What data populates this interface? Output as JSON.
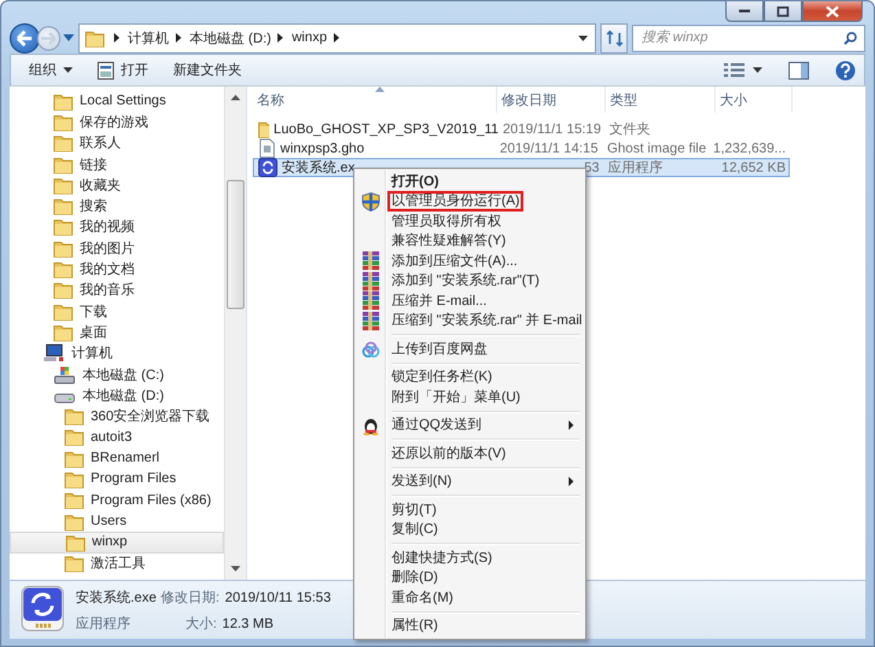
{
  "address": {
    "crumbs": [
      "计算机",
      "本地磁盘 (D:)",
      "winxp"
    ]
  },
  "search": {
    "placeholder": "搜索 winxp"
  },
  "toolbar": {
    "items": [
      {
        "label": "组织",
        "kind": "dropdown"
      },
      {
        "label": "打开",
        "kind": "open"
      },
      {
        "label": "新建文件夹",
        "kind": "plain"
      }
    ]
  },
  "sidebar": {
    "user_folders": [
      {
        "label": "Local Settings",
        "selected": false
      },
      {
        "label": "保存的游戏",
        "selected": false
      },
      {
        "label": "联系人",
        "selected": false
      },
      {
        "label": "链接",
        "selected": false
      },
      {
        "label": "收藏夹",
        "selected": false
      },
      {
        "label": "搜索",
        "selected": false
      },
      {
        "label": "我的视频",
        "selected": false
      },
      {
        "label": "我的图片",
        "selected": false
      },
      {
        "label": "我的文档",
        "selected": false
      },
      {
        "label": "我的音乐",
        "selected": false
      },
      {
        "label": "下载",
        "selected": false
      },
      {
        "label": "桌面",
        "selected": false
      }
    ],
    "tree": [
      {
        "label": "计算机",
        "kind": "computer",
        "selected": false,
        "children": [
          {
            "label": "本地磁盘 (C:)",
            "kind": "system-drive",
            "selected": false
          },
          {
            "label": "本地磁盘 (D:)",
            "kind": "drive",
            "selected": false,
            "children": [
              {
                "label": "360安全浏览器下载",
                "kind": "folder",
                "selected": false
              },
              {
                "label": "autoit3",
                "kind": "folder",
                "selected": false
              },
              {
                "label": "BRenamerl",
                "kind": "folder",
                "selected": false
              },
              {
                "label": "Program Files",
                "kind": "folder",
                "selected": false
              },
              {
                "label": "Program Files (x86)",
                "kind": "folder",
                "selected": false
              },
              {
                "label": "Users",
                "kind": "folder",
                "selected": false
              },
              {
                "label": "winxp",
                "kind": "folder",
                "selected": true
              },
              {
                "label": "激活工具",
                "kind": "folder",
                "selected": false
              }
            ]
          }
        ]
      }
    ]
  },
  "file_list": {
    "columns": [
      {
        "label": "名称",
        "sorted": true
      },
      {
        "label": "修改日期",
        "sorted": false
      },
      {
        "label": "类型",
        "sorted": false
      },
      {
        "label": "大小",
        "sorted": false
      }
    ],
    "rows": [
      {
        "kind": "folder",
        "name": "LuoBo_GHOST_XP_SP3_V2019_11",
        "modified": "2019/11/1 15:19",
        "type": "文件夹",
        "selected": false
      },
      {
        "kind": "file",
        "name": "winxpsp3.gho",
        "modified": "2019/11/1 14:15",
        "type": "Ghost image file",
        "size": "1,232,639...",
        "selected": false
      },
      {
        "kind": "app",
        "name": "安装系统.ex",
        "modified": "53",
        "type": "应用程序",
        "size": "12,652 KB",
        "selected": true
      }
    ]
  },
  "context_menu": {
    "groups": [
      [
        {
          "label": "打开(O)",
          "bold": true,
          "kind": "plain",
          "highlighted": false,
          "submenu": false
        },
        {
          "label": "以管理员身份运行(A)",
          "bold": false,
          "kind": "shield",
          "highlighted": true,
          "submenu": false
        },
        {
          "label": "管理员取得所有权",
          "bold": false,
          "kind": "plain",
          "highlighted": false,
          "submenu": false
        },
        {
          "label": "兼容性疑难解答(Y)",
          "bold": false,
          "kind": "plain",
          "highlighted": false,
          "submenu": false
        },
        {
          "label": "添加到压缩文件(A)...",
          "bold": false,
          "kind": "archive",
          "highlighted": false,
          "submenu": false
        },
        {
          "label": "添加到 \"安装系统.rar\"(T)",
          "bold": false,
          "kind": "archive",
          "highlighted": false,
          "submenu": false
        },
        {
          "label": "压缩并 E-mail...",
          "bold": false,
          "kind": "archive",
          "highlighted": false,
          "submenu": false
        },
        {
          "label": "压缩到 \"安装系统.rar\" 并 E-mail",
          "bold": false,
          "kind": "archive",
          "highlighted": false,
          "submenu": false
        }
      ],
      [
        {
          "label": "上传到百度网盘",
          "bold": false,
          "kind": "cloud",
          "highlighted": false,
          "submenu": false
        }
      ],
      [
        {
          "label": "锁定到任务栏(K)",
          "bold": false,
          "kind": "plain",
          "highlighted": false,
          "submenu": false
        },
        {
          "label": "附到「开始」菜单(U)",
          "bold": false,
          "kind": "plain",
          "highlighted": false,
          "submenu": false
        }
      ],
      [
        {
          "label": "通过QQ发送到",
          "bold": false,
          "kind": "penguin",
          "highlighted": false,
          "submenu": true
        }
      ],
      [
        {
          "label": "还原以前的版本(V)",
          "bold": false,
          "kind": "plain",
          "highlighted": false,
          "submenu": false
        }
      ],
      [
        {
          "label": "发送到(N)",
          "bold": false,
          "kind": "plain",
          "highlighted": false,
          "submenu": true
        }
      ],
      [
        {
          "label": "剪切(T)",
          "bold": false,
          "kind": "plain",
          "highlighted": false,
          "submenu": false
        },
        {
          "label": "复制(C)",
          "bold": false,
          "kind": "plain",
          "highlighted": false,
          "submenu": false
        }
      ],
      [
        {
          "label": "创建快捷方式(S)",
          "bold": false,
          "kind": "plain",
          "highlighted": false,
          "submenu": false
        },
        {
          "label": "删除(D)",
          "bold": false,
          "kind": "plain",
          "highlighted": false,
          "submenu": false
        },
        {
          "label": "重命名(M)",
          "bold": false,
          "kind": "plain",
          "highlighted": false,
          "submenu": false
        }
      ],
      [
        {
          "label": "属性(R)",
          "bold": false,
          "kind": "plain",
          "highlighted": false,
          "submenu": false
        }
      ]
    ]
  },
  "details": {
    "name": "安装系统.exe",
    "date_label": "修改日期:",
    "date": "2019/10/11 15:53",
    "type": "应用程序",
    "size_label": "大小:",
    "size": "12.3 MB"
  }
}
